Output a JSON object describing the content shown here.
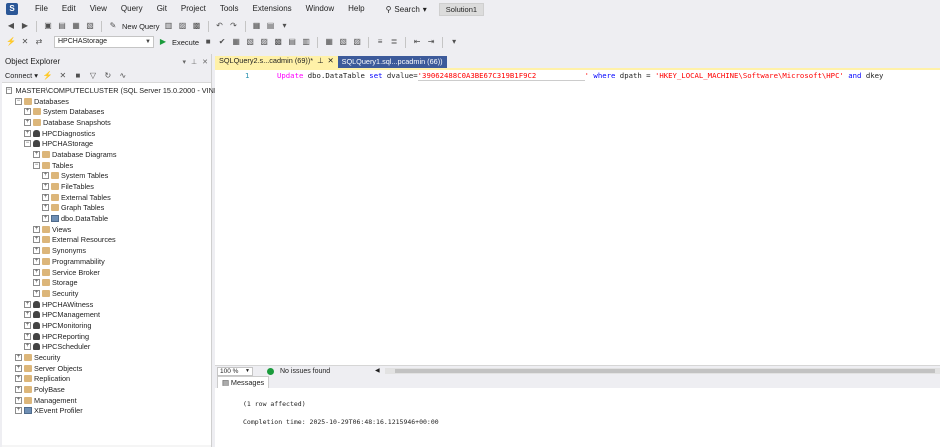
{
  "menu": {
    "items": [
      "File",
      "Edit",
      "View",
      "Query",
      "Git",
      "Project",
      "Tools",
      "Extensions",
      "Window",
      "Help"
    ],
    "search_label": "Search",
    "solution_label": "Solution1"
  },
  "toolbar": {
    "new_query_label": "New Query",
    "database_selected": "HPCHAStorage",
    "execute_label": "Execute"
  },
  "object_explorer": {
    "title": "Object Explorer",
    "connect_label": "Connect",
    "tree": [
      {
        "label": "MASTER\\COMPUTECLUSTER (SQL Server 15.0.2000 - VINIL",
        "indent": 0,
        "toggle": "−",
        "icon": "server"
      },
      {
        "label": "Databases",
        "indent": 1,
        "toggle": "−",
        "icon": "folder"
      },
      {
        "label": "System Databases",
        "indent": 2,
        "toggle": "+",
        "icon": "folder"
      },
      {
        "label": "Database Snapshots",
        "indent": 2,
        "toggle": "+",
        "icon": "folder"
      },
      {
        "label": "HPCDiagnostics",
        "indent": 2,
        "toggle": "+",
        "icon": "db"
      },
      {
        "label": "HPCHAStorage",
        "indent": 2,
        "toggle": "−",
        "icon": "db"
      },
      {
        "label": "Database Diagrams",
        "indent": 3,
        "toggle": "+",
        "icon": "folder"
      },
      {
        "label": "Tables",
        "indent": 3,
        "toggle": "−",
        "icon": "folder"
      },
      {
        "label": "System Tables",
        "indent": 4,
        "toggle": "+",
        "icon": "folder"
      },
      {
        "label": "FileTables",
        "indent": 4,
        "toggle": "+",
        "icon": "folder"
      },
      {
        "label": "External Tables",
        "indent": 4,
        "toggle": "+",
        "icon": "folder"
      },
      {
        "label": "Graph Tables",
        "indent": 4,
        "toggle": "+",
        "icon": "folder"
      },
      {
        "label": "dbo.DataTable",
        "indent": 4,
        "toggle": "+",
        "icon": "table"
      },
      {
        "label": "Views",
        "indent": 3,
        "toggle": "+",
        "icon": "folder"
      },
      {
        "label": "External Resources",
        "indent": 3,
        "toggle": "+",
        "icon": "folder"
      },
      {
        "label": "Synonyms",
        "indent": 3,
        "toggle": "+",
        "icon": "folder"
      },
      {
        "label": "Programmability",
        "indent": 3,
        "toggle": "+",
        "icon": "folder"
      },
      {
        "label": "Service Broker",
        "indent": 3,
        "toggle": "+",
        "icon": "folder"
      },
      {
        "label": "Storage",
        "indent": 3,
        "toggle": "+",
        "icon": "folder"
      },
      {
        "label": "Security",
        "indent": 3,
        "toggle": "+",
        "icon": "folder"
      },
      {
        "label": "HPCHAWitness",
        "indent": 2,
        "toggle": "+",
        "icon": "db"
      },
      {
        "label": "HPCManagement",
        "indent": 2,
        "toggle": "+",
        "icon": "db"
      },
      {
        "label": "HPCMonitoring",
        "indent": 2,
        "toggle": "+",
        "icon": "db"
      },
      {
        "label": "HPCReporting",
        "indent": 2,
        "toggle": "+",
        "icon": "db"
      },
      {
        "label": "HPCScheduler",
        "indent": 2,
        "toggle": "+",
        "icon": "db"
      },
      {
        "label": "Security",
        "indent": 1,
        "toggle": "+",
        "icon": "folder"
      },
      {
        "label": "Server Objects",
        "indent": 1,
        "toggle": "+",
        "icon": "folder"
      },
      {
        "label": "Replication",
        "indent": 1,
        "toggle": "+",
        "icon": "folder"
      },
      {
        "label": "PolyBase",
        "indent": 1,
        "toggle": "+",
        "icon": "folder"
      },
      {
        "label": "Management",
        "indent": 1,
        "toggle": "+",
        "icon": "folder"
      },
      {
        "label": "XEvent Profiler",
        "indent": 1,
        "toggle": "+",
        "icon": "table"
      }
    ]
  },
  "tabs": [
    {
      "label": "SQLQuery2.s...cadmin (69))*",
      "active": true
    },
    {
      "label": "SQLQuery1.sql...pcadmin (66))",
      "active": false
    }
  ],
  "editor": {
    "line_number": "1",
    "code": {
      "kw_update": "Update",
      "table": "dbo.DataTable",
      "kw_set": "set",
      "col1": "dvalue",
      "eq": "=",
      "value1": "'39062488C0A3BE67C319B1F9C2",
      "value1_end": "'",
      "kw_where": "where",
      "col2": "dpath",
      "eq2": " = ",
      "value2": "'HKEY_LOCAL_MACHINE\\Software\\Microsoft\\HPC'",
      "kw_and": "and",
      "col3": "dkey"
    }
  },
  "status": {
    "zoom": "100 %",
    "issues": "No issues found"
  },
  "results": {
    "tab_label": "Messages",
    "line1": "(1 row affected)",
    "line2": "Completion time: 2025-10-29T06:48:16.1215946+00:00"
  }
}
